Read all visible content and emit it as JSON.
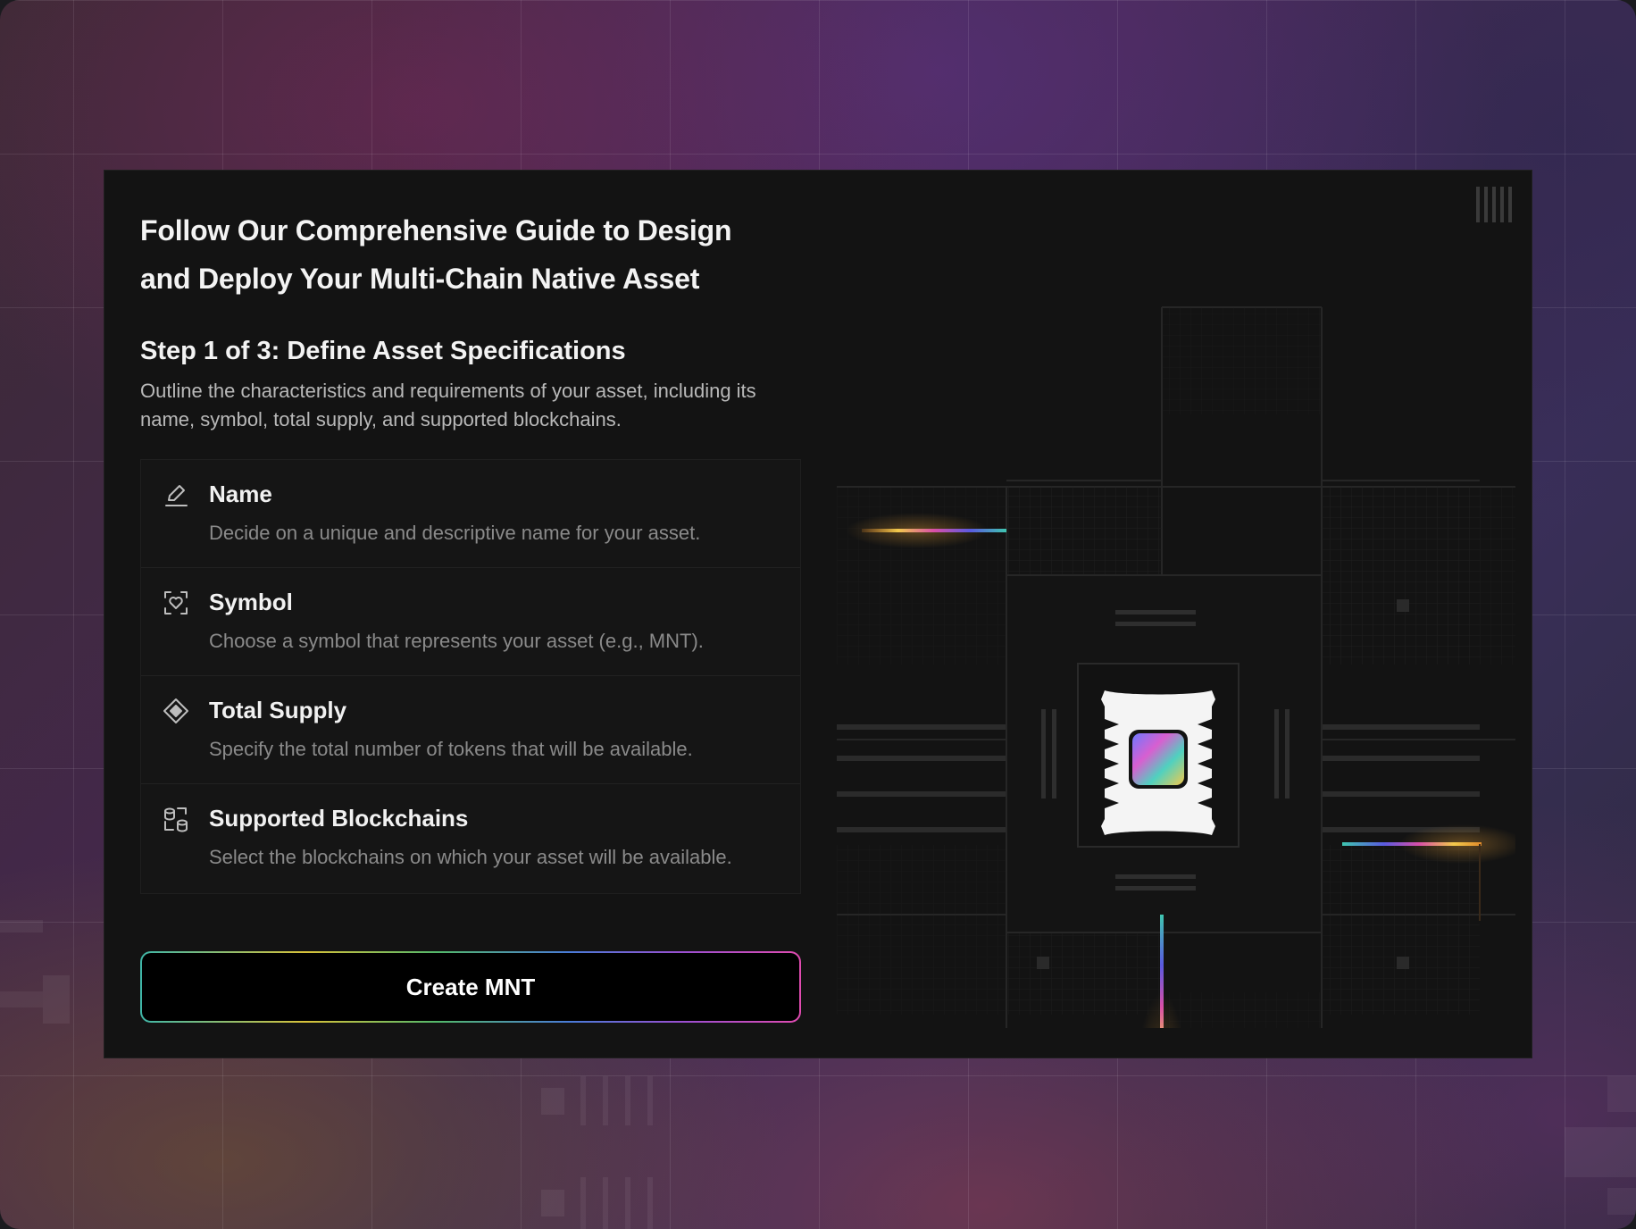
{
  "headline": "Follow Our Comprehensive Guide to Design and Deploy Your Multi-Chain Native Asset",
  "step": {
    "title": "Step 1 of 3: Define Asset Specifications",
    "description": "Outline the characteristics and requirements of your asset, including its name, symbol, total supply, and supported blockchains."
  },
  "specs": [
    {
      "icon": "pencil-icon",
      "title": "Name",
      "description": "Decide on a unique and descriptive name for your asset."
    },
    {
      "icon": "scan-heart-icon",
      "title": "Symbol",
      "description": "Choose a symbol that represents your asset (e.g., MNT)."
    },
    {
      "icon": "diamond-icon",
      "title": "Total Supply",
      "description": "Specify the total number of tokens that will be available."
    },
    {
      "icon": "database-icon",
      "title": "Supported Blockchains",
      "description": "Select the blockchains on which your asset will be available."
    }
  ],
  "cta": {
    "label": "Create MNT"
  },
  "colors": {
    "card_background": "#131313",
    "text_primary": "#f3f3f3",
    "text_secondary": "#8a8a8a",
    "button_background": "#000000"
  }
}
